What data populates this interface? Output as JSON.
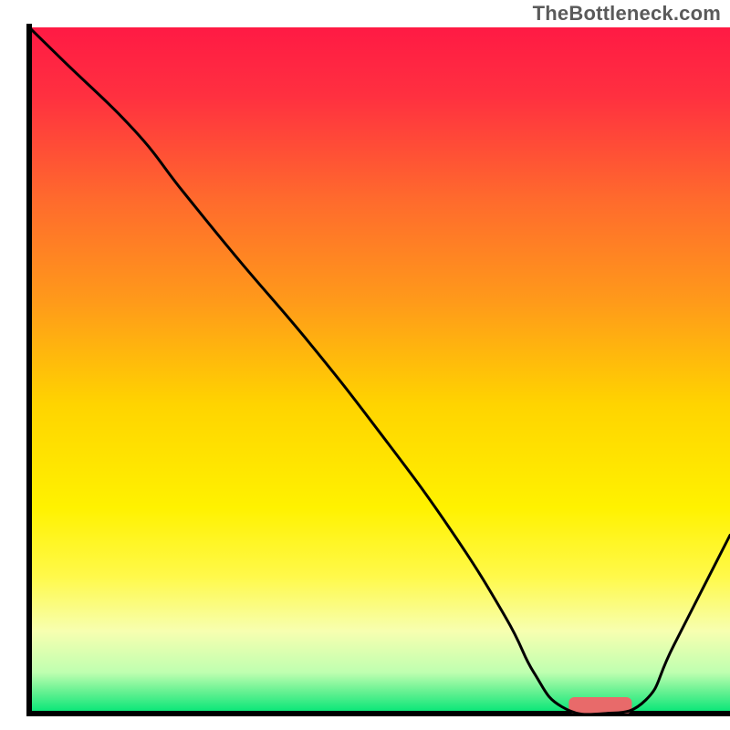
{
  "watermark": "TheBottleneck.com",
  "chart_data": {
    "type": "line",
    "title": "",
    "xlabel": "",
    "ylabel": "",
    "xlim": [
      0,
      100
    ],
    "ylim": [
      0,
      100
    ],
    "grid": false,
    "legend": false,
    "background": {
      "gradient_stops": [
        {
          "offset": 0.0,
          "color": "#ff1a44"
        },
        {
          "offset": 0.1,
          "color": "#ff3040"
        },
        {
          "offset": 0.25,
          "color": "#ff6a2d"
        },
        {
          "offset": 0.4,
          "color": "#ff9a1a"
        },
        {
          "offset": 0.55,
          "color": "#ffd400"
        },
        {
          "offset": 0.7,
          "color": "#fff200"
        },
        {
          "offset": 0.8,
          "color": "#fff94a"
        },
        {
          "offset": 0.88,
          "color": "#f7ffb0"
        },
        {
          "offset": 0.94,
          "color": "#bfffb0"
        },
        {
          "offset": 0.97,
          "color": "#60f090"
        },
        {
          "offset": 1.0,
          "color": "#00e676"
        }
      ]
    },
    "series": [
      {
        "name": "curve",
        "color": "#000000",
        "width": 3,
        "x": [
          0,
          5,
          15,
          22,
          30,
          40,
          50,
          60,
          68,
          72,
          76,
          82,
          88,
          92,
          100
        ],
        "y": [
          100,
          95,
          85,
          76,
          66,
          54,
          41,
          27,
          14,
          6,
          1,
          0,
          2,
          10,
          26
        ]
      }
    ],
    "marker": {
      "name": "optimal-range",
      "color": "#e86a6a",
      "x_start": 77,
      "x_end": 86,
      "y": 0,
      "thickness": 2.4
    },
    "axes": {
      "color": "#000000",
      "width": 6,
      "x_axis": true,
      "y_axis": true
    }
  }
}
